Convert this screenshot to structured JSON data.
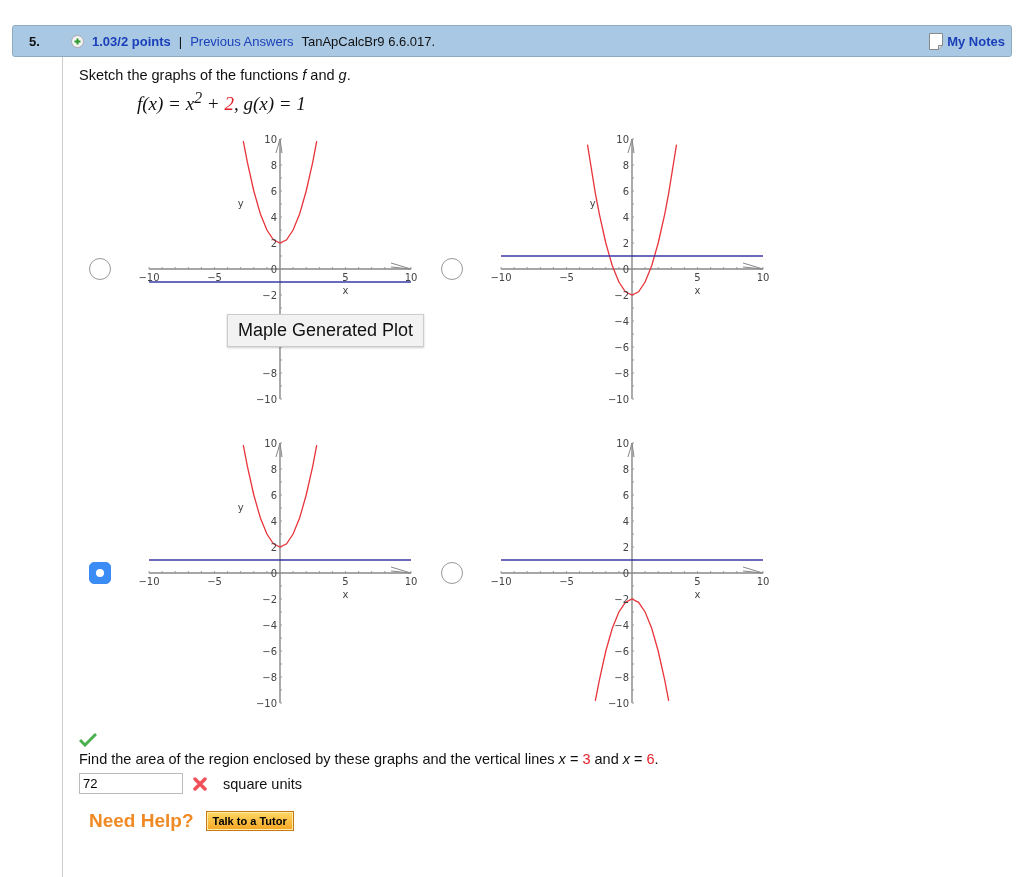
{
  "header": {
    "number": "5.",
    "points": "1.03/2 points",
    "separator": "|",
    "previous_answers": "Previous Answers",
    "problem_id": "TanApCalcBr9 6.6.017.",
    "notes": "My Notes"
  },
  "prompt": "Sketch the graphs of the functions *f* and *g*.",
  "formula": [
    {
      "text": "f(x) = x$^{2}$ + ",
      "highlight": false
    },
    {
      "text": "2",
      "highlight": true
    },
    {
      "text": ", g(x) = 1",
      "highlight": false
    }
  ],
  "options": [
    {
      "selected": false,
      "tooltip": "Maple Generated Plot",
      "chart_data": {
        "type": "line",
        "xlabel": "x",
        "ylabel": "y",
        "x": [
          -10,
          -3.4,
          -2.8,
          -2.5,
          -2,
          -1.5,
          -1,
          -0.5,
          0,
          0.5,
          1,
          1.5,
          2,
          2.5,
          2.8,
          3.4,
          10
        ],
        "xlim": [
          -10,
          10
        ],
        "ylim": [
          -10,
          10
        ],
        "xticks": [
          -10,
          -5,
          5,
          10
        ],
        "yticks": [
          -10,
          -8,
          -2,
          0,
          2,
          4,
          6,
          8,
          10
        ],
        "series": [
          {
            "color": "#e8343a",
            "values": [
              null,
              null,
              9.84,
              8.25,
              6,
              4.25,
              3,
              2.25,
              2,
              2.25,
              3,
              4.25,
              6,
              8.25,
              9.84,
              null,
              null
            ]
          },
          {
            "color": "#3a3aa8",
            "values": [
              -1,
              -1,
              -1,
              -1,
              -1,
              -1,
              -1,
              -1,
              -1,
              -1,
              -1,
              -1,
              -1,
              -1,
              -1,
              -1,
              -1
            ]
          }
        ]
      }
    },
    {
      "selected": false,
      "chart_data": {
        "type": "line",
        "xlabel": "x",
        "ylabel": "y",
        "x": [
          -10,
          -3.4,
          -2.8,
          -2.5,
          -2,
          -1.5,
          -1,
          -0.5,
          0,
          0.5,
          1,
          1.5,
          2,
          2.5,
          2.8,
          3.4,
          10
        ],
        "xlim": [
          -10,
          10
        ],
        "ylim": [
          -10,
          10
        ],
        "xticks": [
          -10,
          -5,
          5,
          10
        ],
        "yticks": [
          -10,
          -8,
          -6,
          -4,
          -2,
          0,
          2,
          4,
          6,
          8,
          10
        ],
        "series": [
          {
            "color": "#e8343a",
            "values": [
              null,
              9.56,
              5.84,
              4.25,
              2,
              0.25,
              -1,
              -1.75,
              -2,
              -1.75,
              -1,
              0.25,
              2,
              4.25,
              5.84,
              9.56,
              null
            ]
          },
          {
            "color": "#3a3aa8",
            "values": [
              1,
              1,
              1,
              1,
              1,
              1,
              1,
              1,
              1,
              1,
              1,
              1,
              1,
              1,
              1,
              1,
              1
            ]
          }
        ]
      }
    },
    {
      "selected": true,
      "chart_data": {
        "type": "line",
        "xlabel": "x",
        "ylabel": "y",
        "x": [
          -10,
          -3.4,
          -2.8,
          -2.5,
          -2,
          -1.5,
          -1,
          -0.5,
          0,
          0.5,
          1,
          1.5,
          2,
          2.5,
          2.8,
          3.4,
          10
        ],
        "xlim": [
          -10,
          10
        ],
        "ylim": [
          -10,
          10
        ],
        "xticks": [
          -10,
          -5,
          5,
          10
        ],
        "yticks": [
          -10,
          -8,
          -6,
          -4,
          -2,
          0,
          2,
          4,
          6,
          8,
          10
        ],
        "series": [
          {
            "color": "#e8343a",
            "values": [
              null,
              null,
              9.84,
              8.25,
              6,
              4.25,
              3,
              2.25,
              2,
              2.25,
              3,
              4.25,
              6,
              8.25,
              9.84,
              null,
              null
            ]
          },
          {
            "color": "#3a3aa8",
            "values": [
              1,
              1,
              1,
              1,
              1,
              1,
              1,
              1,
              1,
              1,
              1,
              1,
              1,
              1,
              1,
              1,
              1
            ]
          }
        ]
      }
    },
    {
      "selected": false,
      "chart_data": {
        "type": "line",
        "xlabel": "x",
        "x": [
          -10,
          -3.4,
          -2.8,
          -2.5,
          -2,
          -1.5,
          -1,
          -0.5,
          0,
          0.5,
          1,
          1.5,
          2,
          2.5,
          2.8,
          3.4,
          10
        ],
        "xlim": [
          -10,
          10
        ],
        "ylim": [
          -10,
          10
        ],
        "xticks": [
          -10,
          -5,
          5,
          10
        ],
        "yticks": [
          -10,
          -8,
          -6,
          -4,
          -2,
          0,
          2,
          4,
          6,
          8,
          10
        ],
        "series": [
          {
            "color": "#e8343a",
            "values": [
              null,
              null,
              -9.84,
              -8.25,
              -6,
              -4.25,
              -3,
              -2.25,
              -2,
              -2.25,
              -3,
              -4.25,
              -6,
              -8.25,
              -9.84,
              null,
              null
            ]
          },
          {
            "color": "#3a3aa8",
            "values": [
              1,
              1,
              1,
              1,
              1,
              1,
              1,
              1,
              1,
              1,
              1,
              1,
              1,
              1,
              1,
              1,
              1
            ]
          }
        ]
      }
    }
  ],
  "part1_correct": true,
  "question": [
    {
      "text": "Find the area of the region enclosed by these graphs and the vertical lines ",
      "highlight": false,
      "italic": false
    },
    {
      "text": "x",
      "highlight": false,
      "italic": true
    },
    {
      "text": " = ",
      "highlight": false,
      "italic": false
    },
    {
      "text": "3",
      "highlight": true,
      "italic": false
    },
    {
      "text": " and ",
      "highlight": false,
      "italic": false
    },
    {
      "text": "x",
      "highlight": false,
      "italic": true
    },
    {
      "text": " = ",
      "highlight": false,
      "italic": false
    },
    {
      "text": "6",
      "highlight": true,
      "italic": false
    },
    {
      "text": ".",
      "highlight": false,
      "italic": false
    }
  ],
  "answer": {
    "value": "72",
    "correct": false,
    "units": "square units"
  },
  "help": {
    "label": "Need Help?",
    "button": "Talk to a Tutor"
  }
}
